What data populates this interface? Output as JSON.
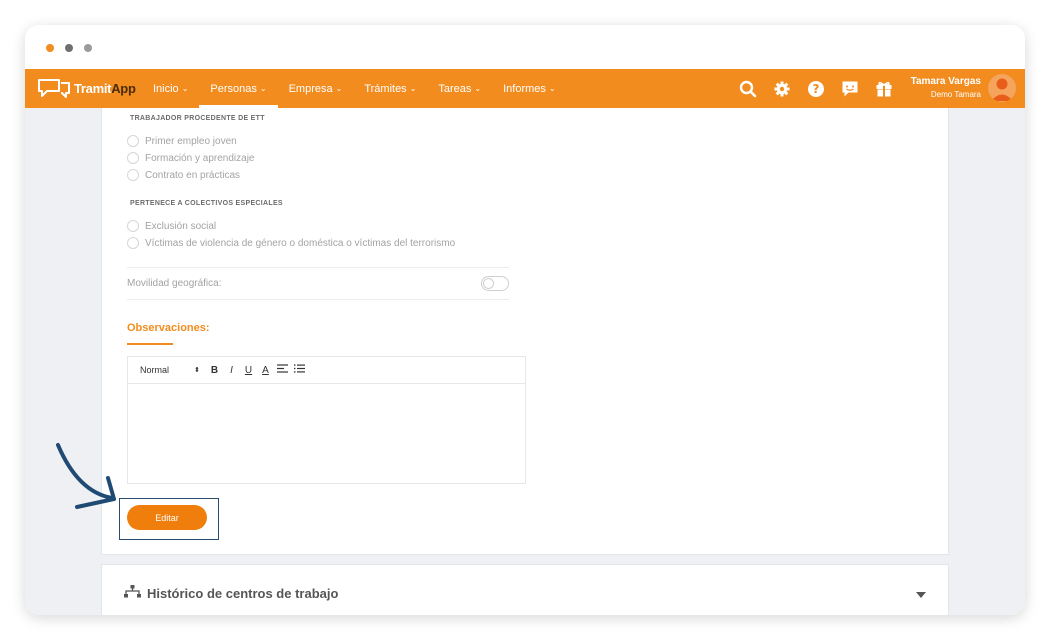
{
  "app": {
    "logo_text": "Tramit",
    "logo_accent": "App"
  },
  "nav": {
    "items": [
      {
        "label": "Inicio"
      },
      {
        "label": "Personas"
      },
      {
        "label": "Empresa"
      },
      {
        "label": "Trámites"
      },
      {
        "label": "Tareas"
      },
      {
        "label": "Informes"
      }
    ],
    "active": "Personas",
    "icons": [
      "search-icon",
      "gear-icon",
      "help-icon",
      "chat-icon",
      "gift-icon"
    ]
  },
  "user": {
    "name": "Tamara Vargas",
    "company": "Demo Tamara"
  },
  "form": {
    "section_ett": {
      "heading": "TRABAJADOR PROCEDENTE DE ETT",
      "options": [
        "Primer empleo joven",
        "Formación y aprendizaje",
        "Contrato en prácticas"
      ]
    },
    "section_colectivos": {
      "heading": "PERTENECE A COLECTIVOS ESPECIALES",
      "options": [
        "Exclusión social",
        "Víctimas de violencia de género o doméstica o víctimas del terrorismo"
      ]
    },
    "mobility_label": "Movilidad geográfica:",
    "mobility_enabled": false,
    "observations_title": "Observaciones:",
    "editor": {
      "format_value": "Normal",
      "tools": [
        "B",
        "I",
        "U",
        "A"
      ],
      "content": ""
    },
    "edit_button": "Editar"
  },
  "history_card": {
    "title": "Histórico de centros de trabajo"
  },
  "colors": {
    "brand": "#f28c1e",
    "button": "#f07e0d",
    "highlight": "#2a4c6f"
  }
}
